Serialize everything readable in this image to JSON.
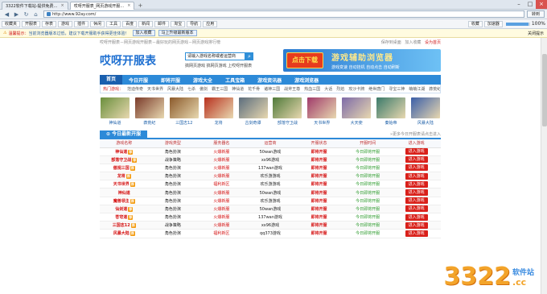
{
  "browser": {
    "tabs": [
      {
        "title": "3322软件下载站-提供免费…",
        "active": false
      },
      {
        "title": "哎呀开服表_网页游戏开服…",
        "active": true
      }
    ],
    "address": "http://www.92ay.com/",
    "go_label": "转到",
    "favorites": [
      "收藏夹",
      "开服表",
      "存表",
      "游戏",
      "插件",
      "休闲",
      "工具",
      "百度",
      "新闻",
      "邮件",
      "淘宝",
      "导航",
      "应用"
    ],
    "fav_right": [
      "收藏",
      "加速器"
    ],
    "zoom": "100%",
    "notice_icon": "warning-icon",
    "notice_text": "温馨提示：",
    "notice_msg": "当前浏览器版本过低，建议下载开服助手获得更佳体验！",
    "notice_btn1": "加入收藏",
    "notice_btn2": "马上升级最新版本",
    "notice_close": "关闭提示"
  },
  "site": {
    "top_left": "哎呀开服表－网页游戏开服表－最好玩的网页游戏－网页游戏排行榜",
    "top_links": [
      "保存到桌面",
      "加入收藏",
      "设为首页"
    ],
    "logo": "哎呀开服表",
    "search_label": "请输入游戏名称或者运营商",
    "search_placeholder": "",
    "hot_words": "搞网页游戏 搞网页游戏 上哎呀开服表",
    "banner_dl": "点击下载",
    "banner_title": "游戏辅助浏览器",
    "banner_sub": "游戏变速 自动挂机 自动点击 自动刷新",
    "nav": [
      "首页",
      "今日开服",
      "即将开服",
      "游戏大全",
      "工具宝箱",
      "游戏资讯器",
      "游戏浏览器"
    ],
    "subnav_label": "热门游戏：",
    "subnav": [
      "范迪传奇",
      "天书世界",
      "风暴大陆",
      "七杀",
      "傲剑",
      "霸王三国",
      "神仙道",
      "花千骨",
      "诸神三国",
      "战斧王尊",
      "热血三国",
      "大话",
      "烈焰",
      "攻沙卡牌",
      "绝世唐门",
      "寻宝三神",
      "萌萌江湖",
      "莽荒纪"
    ],
    "games": [
      {
        "name": "神仙道",
        "color": "#6a8f3c"
      },
      {
        "name": "莽荒纪",
        "color": "#7a3a2a"
      },
      {
        "name": "三国志12",
        "color": "#8b5a2b"
      },
      {
        "name": "龙将",
        "color": "#b8301e"
      },
      {
        "name": "古剑奇谭",
        "color": "#5b6d7d"
      },
      {
        "name": "部落守卫战",
        "color": "#4f7a3a"
      },
      {
        "name": "天书世界",
        "color": "#a03a6a"
      },
      {
        "name": "大天使",
        "color": "#7d6aa8"
      },
      {
        "name": "秦始帝",
        "color": "#3a7a6a"
      },
      {
        "name": "风暴大陆",
        "color": "#3a5ea8"
      }
    ],
    "list_title": "今日最新开服",
    "list_more": "»更多今日开服表请点击进入",
    "columns": [
      "游戏名称",
      "游戏类型",
      "服务器名",
      "运营商",
      "开服状态",
      "开服时间",
      "进入游戏"
    ],
    "rows": [
      {
        "name": "神仙道",
        "hot": true,
        "type": "角色扮演",
        "server": "火爆新服",
        "op": "50wan游戏",
        "status": "即将开服",
        "time": "今日即将开服",
        "btn": "进入游戏"
      },
      {
        "name": "部落守卫战",
        "hot": true,
        "type": "战争策略",
        "server": "火爆新服",
        "op": "xx96游戏",
        "status": "即将开服",
        "time": "今日即将开服",
        "btn": "进入游戏"
      },
      {
        "name": "傲视三国",
        "hot": true,
        "type": "角色扮演",
        "server": "火爆新服",
        "op": "137wan游戏",
        "status": "即将开服",
        "time": "今日即将开服",
        "btn": "进入游戏"
      },
      {
        "name": "龙将",
        "hot": true,
        "type": "角色扮演",
        "server": "火爆新服",
        "op": "欢乐游游戏",
        "status": "即将开服",
        "time": "今日即将开服",
        "btn": "进入游戏"
      },
      {
        "name": "天书世界",
        "hot": true,
        "type": "角色扮演",
        "server": "福利新区",
        "op": "欢乐游游戏",
        "status": "即将开服",
        "time": "今日即将开服",
        "btn": "进入游戏"
      },
      {
        "name": "神仙道",
        "hot": false,
        "type": "角色扮演",
        "server": "火爆新服",
        "op": "50wan游戏",
        "status": "即将开服",
        "time": "今日即将开服",
        "btn": "进入游戏"
      },
      {
        "name": "魔兽领主",
        "hot": true,
        "type": "角色扮演",
        "server": "火爆新服",
        "op": "欢乐游游戏",
        "status": "即将开服",
        "time": "今日即将开服",
        "btn": "进入游戏"
      },
      {
        "name": "仙剑道",
        "hot": true,
        "type": "角色扮演",
        "server": "火爆新服",
        "op": "50wan游戏",
        "status": "即将开服",
        "time": "今日即将开服",
        "btn": "进入游戏"
      },
      {
        "name": "苍穹道",
        "hot": true,
        "type": "角色扮演",
        "server": "火爆新服",
        "op": "137wan游戏",
        "status": "即将开服",
        "time": "今日即将开服",
        "btn": "进入游戏"
      },
      {
        "name": "三国志12",
        "hot": true,
        "type": "战争策略",
        "server": "火爆新服",
        "op": "xx96游戏",
        "status": "即将开服",
        "time": "今日即将开服",
        "btn": "进入游戏"
      },
      {
        "name": "风暴大陆",
        "hot": true,
        "type": "角色扮演",
        "server": "福利新区",
        "op": "qq373游戏",
        "status": "即将开服",
        "time": "今日即将开服",
        "btn": "进入游戏"
      }
    ],
    "hot_badge": "荐"
  },
  "watermark": {
    "num": "3322",
    "top": "软件站",
    "bottom": ".cc"
  }
}
